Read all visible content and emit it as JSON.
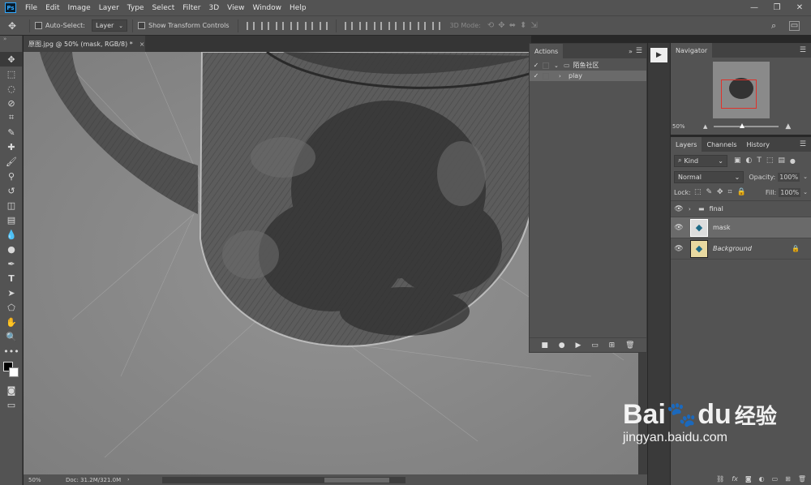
{
  "app": {
    "logo": "Ps"
  },
  "menu": [
    "File",
    "Edit",
    "Image",
    "Layer",
    "Type",
    "Select",
    "Filter",
    "3D",
    "View",
    "Window",
    "Help"
  ],
  "options": {
    "auto_select_label": "Auto-Select:",
    "auto_select_value": "Layer",
    "show_transform_label": "Show Transform Controls",
    "mode_3d_label": "3D Mode:"
  },
  "document": {
    "tab_title": "原图.jpg @ 50% (mask, RGB/8) *",
    "close_glyph": "×"
  },
  "status": {
    "zoom": "50%",
    "doc_info": "Doc: 31.2M/321.0M"
  },
  "actions_panel": {
    "title": "Actions",
    "rows": [
      {
        "checked": true,
        "label": "陌鱼社区",
        "type": "set"
      },
      {
        "checked": true,
        "label": "play",
        "type": "action"
      }
    ]
  },
  "navigator": {
    "title": "Navigator",
    "zoom": "50%"
  },
  "layers_panel": {
    "tabs": [
      "Layers",
      "Channels",
      "History"
    ],
    "kind_label": "Kind",
    "blend_mode": "Normal",
    "opacity_label": "Opacity:",
    "opacity_value": "100%",
    "lock_label": "Lock:",
    "fill_label": "Fill:",
    "fill_value": "100%",
    "layers": [
      {
        "name": "final",
        "type": "group",
        "visible": true
      },
      {
        "name": "mask",
        "type": "layer",
        "visible": true,
        "selected": true
      },
      {
        "name": "Background",
        "type": "background",
        "visible": true,
        "locked": true
      }
    ],
    "footer_fx": "fx"
  },
  "watermark": {
    "text_bai": "Bai",
    "text_du": "du",
    "text_cn": "经验",
    "url": "jingyan.baidu.com"
  },
  "colors": {
    "chrome": "#535353",
    "panel_dark": "#424242",
    "accent_red": "#e0312a",
    "blue": "#31a8ff"
  }
}
